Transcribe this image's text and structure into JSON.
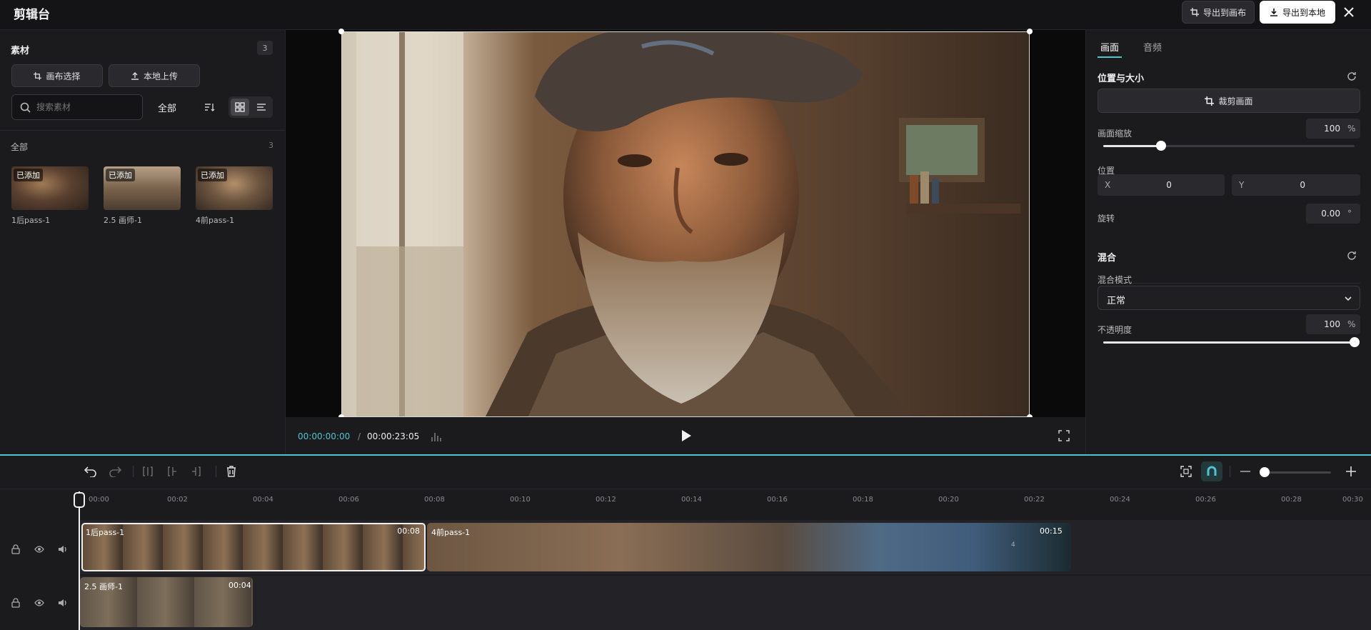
{
  "app": {
    "title": "剪辑台"
  },
  "header": {
    "export_canvas_label": "导出到画布",
    "export_local_label": "导出到本地"
  },
  "materials": {
    "title": "素材",
    "count": "3",
    "canvas_select_label": "画布选择",
    "local_upload_label": "本地上传",
    "search_placeholder": "搜索素材",
    "filter_label": "全部",
    "group_label": "全部",
    "group_count": "3",
    "items": [
      {
        "tag": "已添加",
        "name": "1后pass-1"
      },
      {
        "tag": "已添加",
        "name": "2.5 画师-1"
      },
      {
        "tag": "已添加",
        "name": "4前pass-1"
      }
    ]
  },
  "player": {
    "current_time": "00:00:00:00",
    "separator": "/",
    "total_time": "00:00:23:05"
  },
  "properties": {
    "tabs": [
      {
        "label": "画面"
      },
      {
        "label": "音频"
      }
    ],
    "position_section": "位置与大小",
    "crop_label": "裁剪画面",
    "scale_label": "画面缩放",
    "scale_value": "100",
    "scale_unit": "%",
    "scale_level": 0.23,
    "position_label": "位置",
    "x_label": "X",
    "x_value": "0",
    "y_label": "Y",
    "y_value": "0",
    "rotation_label": "旋转",
    "rotation_value": "0.00",
    "rotation_unit": "°",
    "blend_section": "混合",
    "blend_mode_label": "混合模式",
    "blend_mode_value": "正常",
    "opacity_label": "不透明度",
    "opacity_value": "100",
    "opacity_unit": "%",
    "opacity_level": 1.0
  },
  "timeline": {
    "ticks": [
      "00:00",
      "00:02",
      "00:04",
      "00:06",
      "00:08",
      "00:10",
      "00:12",
      "00:14",
      "00:16",
      "00:18",
      "00:20",
      "00:22",
      "00:24",
      "00:26",
      "00:28",
      "00:30"
    ],
    "clips": [
      {
        "name": "1后pass-1",
        "duration": "00:08"
      },
      {
        "name": "4前pass-1",
        "duration": "00:15"
      },
      {
        "name": "2.5 画师-1",
        "duration": "00:04"
      }
    ],
    "clip_marker": "4"
  },
  "colors": {
    "accent": "#4fc4cf",
    "panel": "#1b1b1e",
    "background": "#141416"
  }
}
